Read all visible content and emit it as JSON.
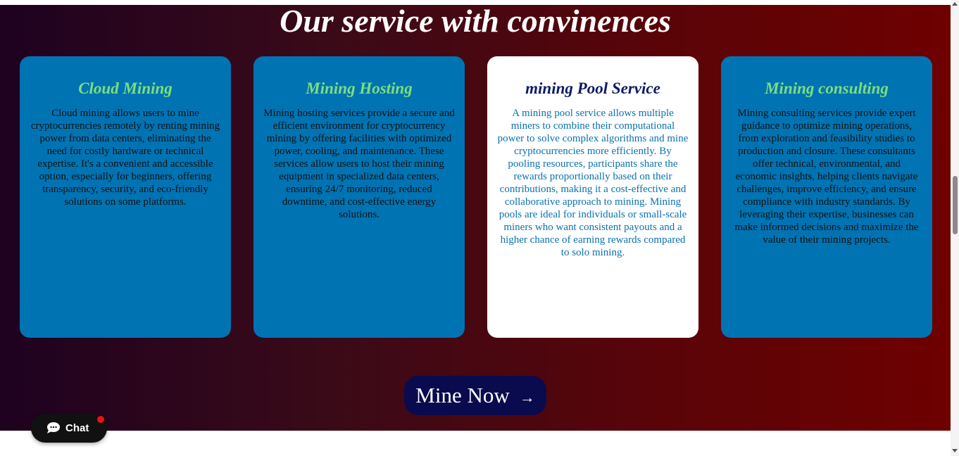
{
  "section": {
    "title": "Our service with convinences"
  },
  "cards": [
    {
      "title": "Cloud Mining",
      "body": "Cloud mining allows users to mine cryptocurrencies remotely by renting mining power from data centers, eliminating the need for costly hardware or technical expertise. It's a convenient and accessible option, especially for beginners, offering transparency, security, and eco-friendly solutions on some platforms."
    },
    {
      "title": "Mining Hosting",
      "body": "Mining hosting services provide a secure and efficient environment for cryptocurrency mining by offering facilities with optimized power, cooling, and maintenance. These services allow users to host their mining equipment in specialized data centers, ensuring 24/7 monitoring, reduced downtime, and cost-effective energy solutions."
    },
    {
      "title": "mining Pool Service",
      "body": "A mining pool service allows multiple miners to combine their computational power to solve complex algorithms and mine cryptocurrencies more efficiently. By pooling resources, participants share the rewards proportionally based on their contributions, making it a cost-effective and collaborative approach to mining. Mining pools are ideal for individuals or small-scale miners who want consistent payouts and a higher chance of earning rewards compared to solo mining."
    },
    {
      "title": "Mining consulting",
      "body": "Mining consulting services provide expert guidance to optimize mining operations, from exploration and feasibility studies to production and closure. These consultants offer technical, environmental, and economic insights, helping clients navigate challenges, improve efficiency, and ensure compliance with industry standards. By leveraging their expertise, businesses can make informed decisions and maximize the value of their mining projects."
    }
  ],
  "cta": {
    "label": "Mine Now",
    "arrow": "→"
  },
  "chat": {
    "label": "Chat",
    "icon": "chat-bubble-icon"
  },
  "colors": {
    "card_bg": "#0073b3",
    "card_active_bg": "#ffffff",
    "card_title": "#7be07b",
    "card_active_title": "#0d1a66",
    "card_active_text": "#0a72b0",
    "cta_bg": "#0a0a4e",
    "gradient_start": "#1e0220",
    "gradient_end": "#6e0000",
    "notification_dot": "#ee1111"
  }
}
